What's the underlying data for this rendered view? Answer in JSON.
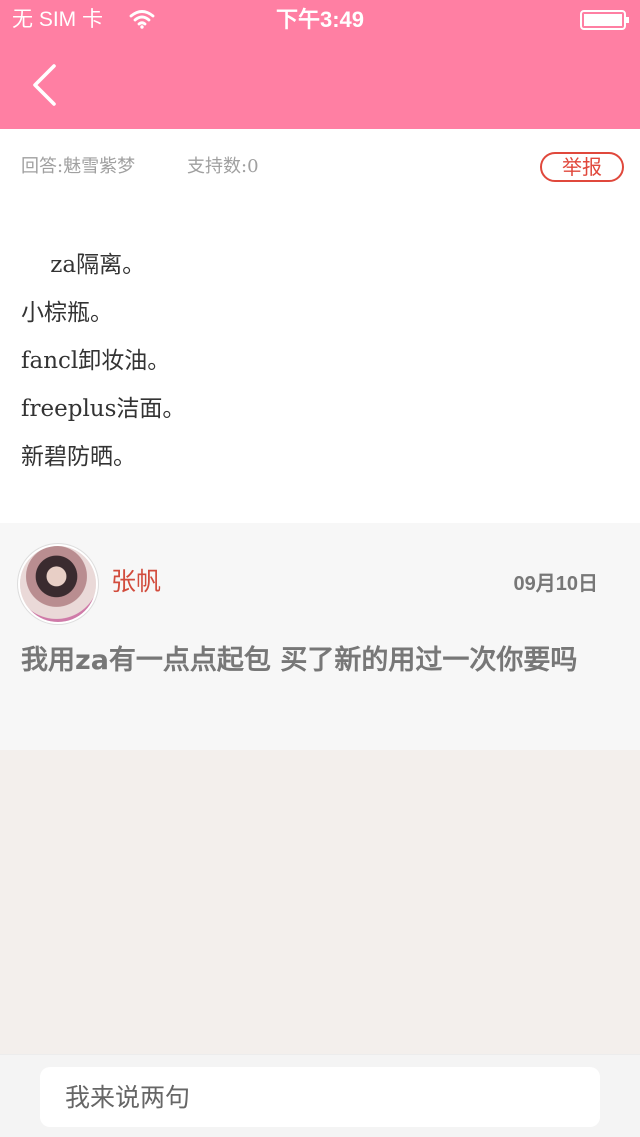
{
  "status_bar": {
    "carrier": "无 SIM 卡",
    "time": "下午3:49",
    "wifi_icon": "wifi-icon",
    "battery_icon": "battery-icon"
  },
  "nav": {
    "back_icon": "chevron-left-icon",
    "color": "#ff7fa3"
  },
  "answer": {
    "author_label": "回答:魅雪紫梦",
    "support_label": "支持数:0",
    "report_label": "举报",
    "lines": [
      "    za隔离。",
      "小棕瓶。",
      "fancl卸妆油。",
      "freeplus洁面。",
      "新碧防晒。"
    ]
  },
  "comment": {
    "avatar_icon": "avatar",
    "name": "张帆",
    "date": "09月10日",
    "text": "我用za有一点点起包 买了新的用过一次你要吗"
  },
  "input": {
    "placeholder": "我来说两句"
  },
  "colors": {
    "accent": "#ff7fa3",
    "red": "#e0483c",
    "name": "#d24c3d"
  }
}
